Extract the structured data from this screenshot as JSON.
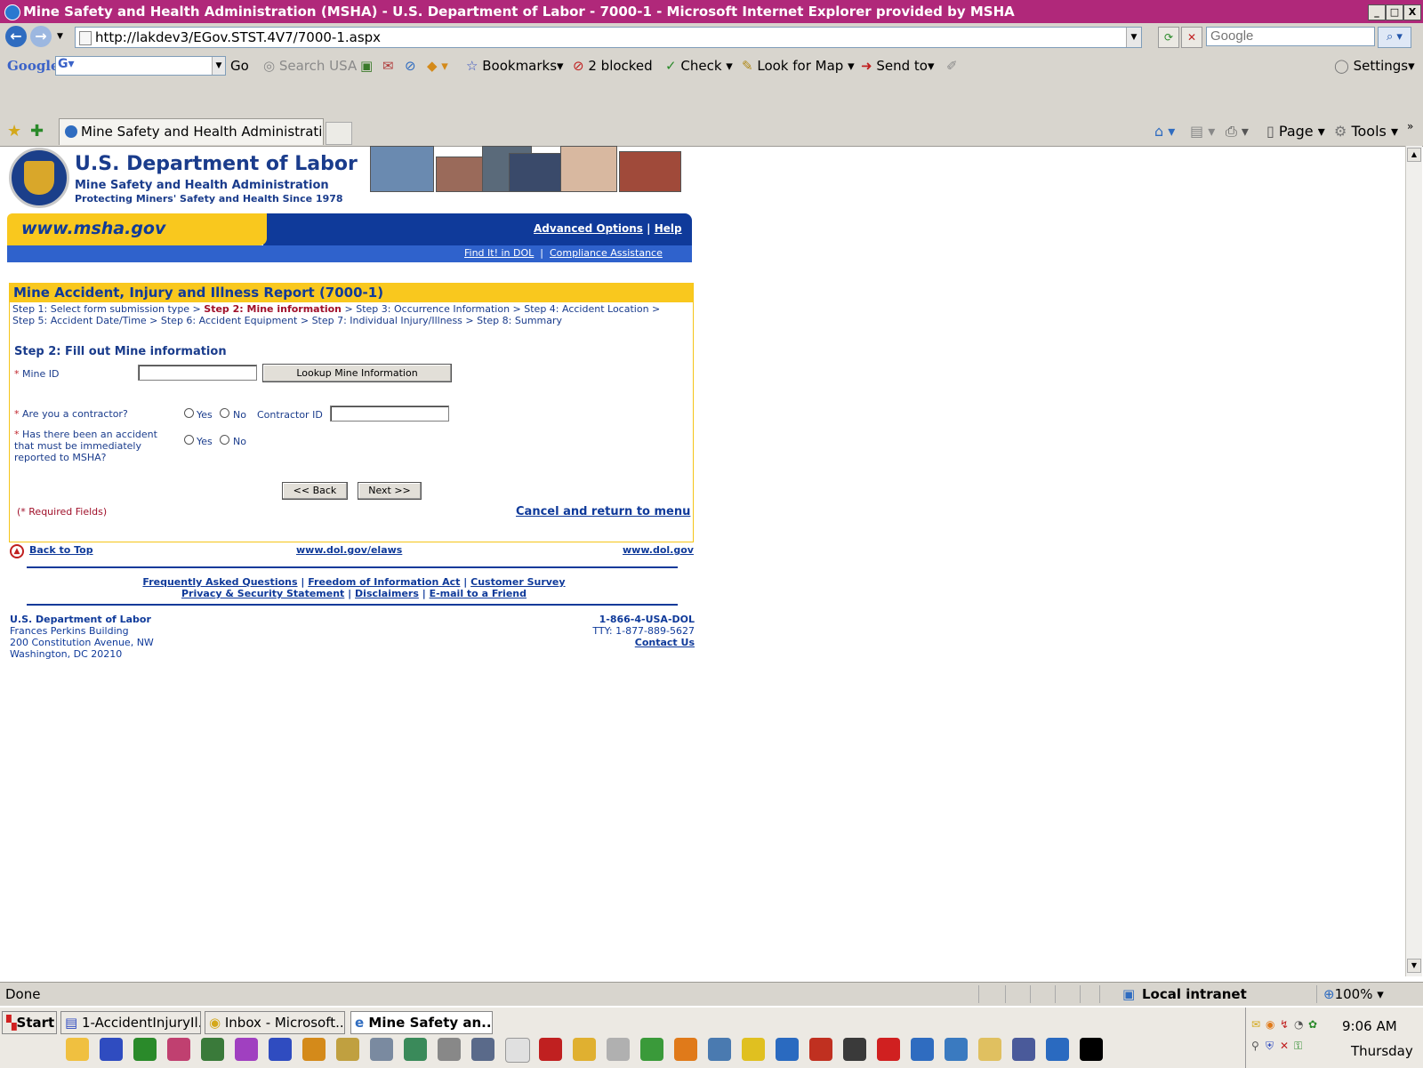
{
  "window": {
    "title": "Mine Safety and Health Administration (MSHA) - U.S. Department of Labor - 7000-1 - Microsoft Internet Explorer provided by MSHA",
    "minimize": "_",
    "maximize": "□",
    "close": "X"
  },
  "browser": {
    "url": "http://lakdev3/EGov.STST.4V7/7000-1.aspx",
    "search_placeholder": "Google",
    "google_label": "Google",
    "go_label": "Go",
    "search_usa": "Search USA",
    "bookmarks": "Bookmarks",
    "blocked": "2 blocked",
    "check": "Check",
    "look_for_map": "Look for Map",
    "send_to": "Send to",
    "settings": "Settings",
    "tab_label": "Mine Safety and Health Administration ...",
    "page_menu": "Page",
    "tools_menu": "Tools"
  },
  "header": {
    "dept": "U.S. Department of Labor",
    "agency": "Mine Safety and Health Administration",
    "tagline": "Protecting Miners' Safety and Health Since 1978",
    "site_url": "www.msha.gov",
    "advanced_options": "Advanced Options",
    "help": "Help",
    "find_it": "Find It! in DOL",
    "compliance": "Compliance Assistance",
    "sep": "|"
  },
  "form": {
    "heading": "Mine Accident, Injury and Illness Report (7000-1)",
    "steps_line1_a": "Step 1: Select form submission type > ",
    "steps_line1_cur": "Step 2: Mine information",
    "steps_line1_b": " > Step 3: Occurrence Information > Step 4: Accident Location >",
    "steps_line2": "Step 5: Accident Date/Time > Step 6: Accident Equipment > Step 7: Individual Injury/Illness > Step 8: Summary",
    "step_title": "Step 2: Fill out Mine information",
    "req_mark": "*",
    "mine_id_label": "Mine ID",
    "mine_id_value": "",
    "lookup_button": "Lookup Mine Information",
    "contractor_label": "Are you a contractor?",
    "yes": "Yes",
    "no": "No",
    "contractor_id_label": "Contractor ID",
    "contractor_id_value": "",
    "accident_label_1": "Has there been an accident",
    "accident_label_2": "that must be immediately",
    "accident_label_3": "reported to MSHA?",
    "back_button": "<< Back",
    "next_button": "Next >>",
    "required_note": "(* Required Fields)",
    "cancel_link": "Cancel and return to menu"
  },
  "footer": {
    "back_to_top": "Back to Top",
    "elaws": "www.dol.gov/elaws",
    "dolgov": "www.dol.gov",
    "faq": "Frequently Asked Questions",
    "foia": "Freedom of Information Act",
    "survey": "Customer Survey",
    "privacy": "Privacy & Security Statement",
    "disclaimers": "Disclaimers",
    "email_friend": "E-mail to a Friend",
    "sep": "|",
    "addr_title": "U.S. Department of Labor",
    "addr_1": "Frances Perkins Building",
    "addr_2": "200 Constitution Avenue, NW",
    "addr_3": "Washington, DC 20210",
    "phone": "1-866-4-USA-DOL",
    "tty": "TTY: 1-877-889-5627",
    "contact": "Contact Us"
  },
  "status": {
    "text": "Done",
    "zone": "Local intranet",
    "zoom": "100%"
  },
  "taskbar": {
    "start": "Start",
    "task1": "1-AccidentInjuryIl...",
    "task2": "Inbox - Microsoft...",
    "task3": "Mine Safety an...",
    "time": "9:06 AM",
    "day": "Thursday"
  }
}
